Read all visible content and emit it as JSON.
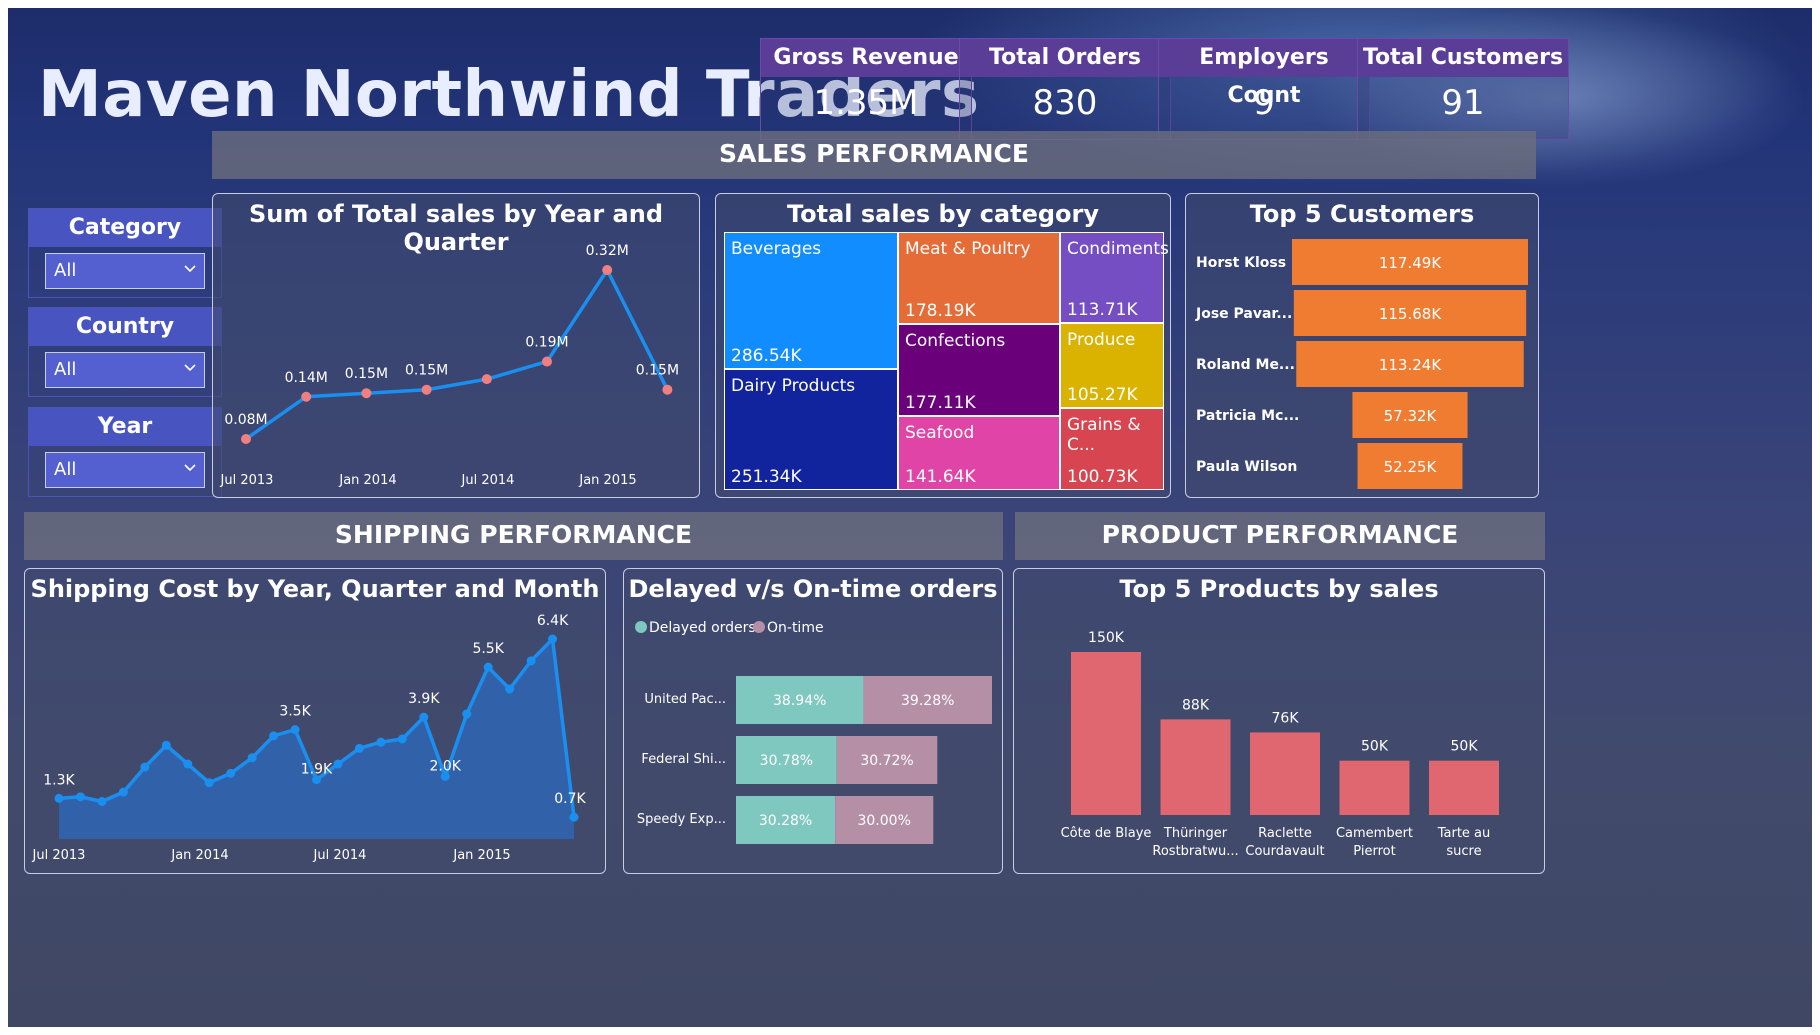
{
  "header": {
    "title": "Maven Northwind Traders"
  },
  "kpis": [
    {
      "label": "Gross Revenue",
      "value": "1.35M"
    },
    {
      "label": "Total Orders",
      "value": "830"
    },
    {
      "label": "Employers Count",
      "value": "9"
    },
    {
      "label": "Total Customers",
      "value": "91"
    }
  ],
  "sections": {
    "sales": "SALES PERFORMANCE",
    "shipping": "SHIPPING PERFORMANCE",
    "product": "PRODUCT PERFORMANCE"
  },
  "slicers": [
    {
      "label": "Category",
      "value": "All"
    },
    {
      "label": "Country",
      "value": "All"
    },
    {
      "label": "Year",
      "value": "All"
    }
  ],
  "colors": {
    "accent": "#5a3d96",
    "line": "#1b8ff0",
    "marker": "#f08080",
    "bar_orange": "#f07c32",
    "bar_red": "#e06670",
    "delayed": "#7fc8c0",
    "ontime": "#b48fa6"
  },
  "chart_data": [
    {
      "id": "sales_by_quarter",
      "type": "line",
      "title": "Sum of Total sales by Year and Quarter",
      "x": [
        "2013 Q3",
        "2013 Q4",
        "2014 Q1",
        "2014 Q2",
        "2014 Q3",
        "2014 Q4",
        "2015 Q1",
        "2015 Q2"
      ],
      "x_ticks": [
        "Jul 2013",
        "Jan 2014",
        "Jul 2014",
        "Jan 2015"
      ],
      "values": [
        0.08,
        0.14,
        0.15,
        0.15,
        null,
        0.19,
        0.32,
        0.15
      ],
      "values_plot": [
        0.08,
        0.14,
        0.145,
        0.15,
        0.165,
        0.19,
        0.32,
        0.15
      ],
      "labels": [
        "0.08M",
        "0.14M",
        "0.15M",
        "0.15M",
        "",
        "0.19M",
        "0.32M",
        "0.15M"
      ],
      "ylim": [
        0,
        0.35
      ]
    },
    {
      "id": "sales_by_category",
      "type": "treemap",
      "title": "Total sales by category",
      "items": [
        {
          "name": "Beverages",
          "value": "286.54K",
          "color": "#118dff"
        },
        {
          "name": "Dairy Products",
          "value": "251.34K",
          "color": "#12239e"
        },
        {
          "name": "Meat & Poultry",
          "value": "178.19K",
          "color": "#e66c37"
        },
        {
          "name": "Confections",
          "value": "177.11K",
          "color": "#6b007b"
        },
        {
          "name": "Seafood",
          "value": "141.64K",
          "color": "#e044a7"
        },
        {
          "name": "Condiments",
          "value": "113.71K",
          "color": "#744ec2"
        },
        {
          "name": "Produce",
          "value": "105.27K",
          "color": "#d9b300"
        },
        {
          "name": "Grains & C...",
          "value": "100.73K",
          "color": "#d64550"
        }
      ]
    },
    {
      "id": "top_customers",
      "type": "bar",
      "orientation": "horizontal",
      "title": "Top 5 Customers",
      "categories": [
        "Horst Kloss",
        "Jose Pavar...",
        "Roland Me...",
        "Patricia Mc...",
        "Paula Wilson"
      ],
      "values": [
        117.49,
        115.68,
        113.24,
        57.32,
        52.25
      ],
      "labels": [
        "117.49K",
        "115.68K",
        "113.24K",
        "57.32K",
        "52.25K"
      ]
    },
    {
      "id": "shipping_cost",
      "type": "area",
      "title": "Shipping Cost by Year, Quarter and Month",
      "x_ticks": [
        "Jul 2013",
        "Jan 2014",
        "Jul 2014",
        "Jan 2015"
      ],
      "values": [
        1.3,
        1.35,
        1.2,
        1.5,
        2.3,
        3.0,
        2.4,
        1.8,
        2.1,
        2.6,
        3.3,
        3.5,
        1.9,
        2.4,
        2.9,
        3.1,
        3.2,
        3.9,
        2.0,
        4.0,
        5.5,
        4.8,
        5.7,
        6.4,
        0.7
      ],
      "labels": {
        "0": "1.3K",
        "11": "3.5K",
        "12": "1.9K",
        "17": "3.9K",
        "18": "2.0K",
        "20": "5.5K",
        "23": "6.4K",
        "24": "0.7K"
      },
      "ylim": [
        0,
        7
      ]
    },
    {
      "id": "delayed_vs_ontime",
      "type": "bar",
      "orientation": "horizontal",
      "stacked": true,
      "title": "Delayed v/s On-time orders",
      "categories": [
        "United Pac...",
        "Federal Shi...",
        "Speedy Exp..."
      ],
      "series": [
        {
          "name": "Delayed orders",
          "values": [
            38.94,
            30.78,
            30.28
          ],
          "labels": [
            "38.94%",
            "30.78%",
            "30.28%"
          ]
        },
        {
          "name": "On-time",
          "values": [
            39.28,
            30.72,
            30.0
          ],
          "labels": [
            "39.28%",
            "30.72%",
            "30.00%"
          ]
        }
      ]
    },
    {
      "id": "top_products",
      "type": "bar",
      "title": "Top 5 Products by sales",
      "categories": [
        "Côte de Blaye",
        "Thüringer Rostbratwu...",
        "Raclette Courdavault",
        "Camembert Pierrot",
        "Tarte au sucre"
      ],
      "category_lines": [
        [
          "Côte de Blaye"
        ],
        [
          "Thüringer",
          "Rostbratwu..."
        ],
        [
          "Raclette",
          "Courdavault"
        ],
        [
          "Camembert",
          "Pierrot"
        ],
        [
          "Tarte au",
          "sucre"
        ]
      ],
      "values": [
        150,
        88,
        76,
        50,
        50
      ],
      "labels": [
        "150K",
        "88K",
        "76K",
        "50K",
        "50K"
      ],
      "ylim": [
        0,
        160
      ]
    }
  ]
}
